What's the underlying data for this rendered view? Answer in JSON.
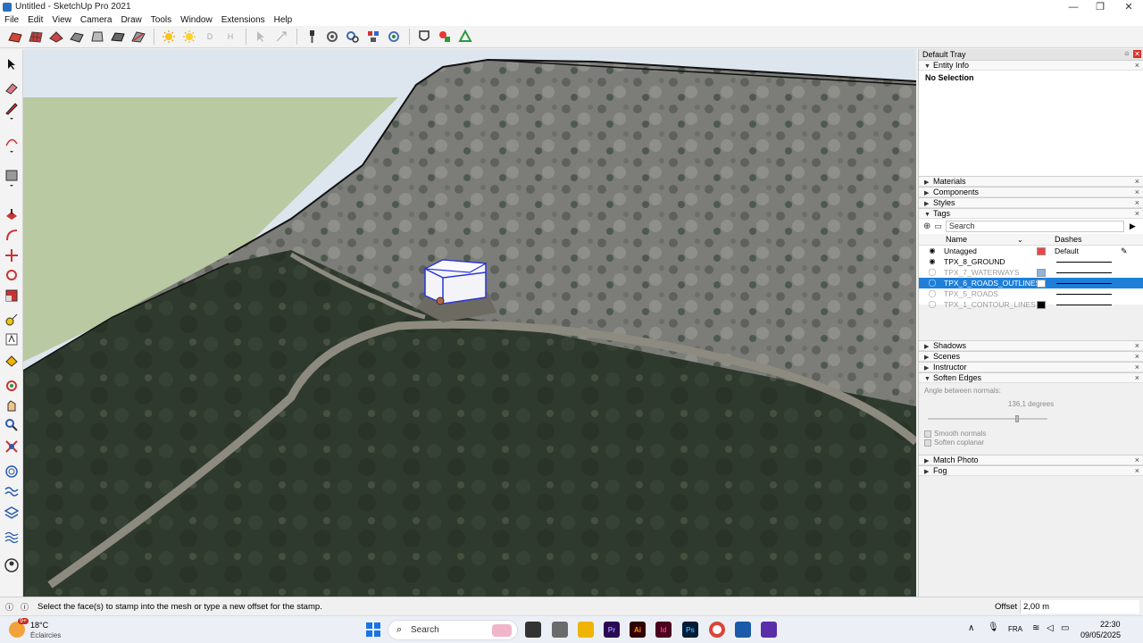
{
  "window": {
    "title": "Untitled - SketchUp Pro 2021",
    "minimize": "—",
    "maximize": "❐",
    "close": "✕"
  },
  "menu": [
    "File",
    "Edit",
    "View",
    "Camera",
    "Draw",
    "Tools",
    "Window",
    "Extensions",
    "Help"
  ],
  "toolbar": {
    "shadow_d": "D",
    "shadow_h": "H"
  },
  "tray": {
    "title": "Default Tray",
    "entity_info": {
      "label": "Entity Info",
      "selection": "No Selection"
    },
    "panels_top": [
      "Materials",
      "Components",
      "Styles"
    ],
    "tags": {
      "label": "Tags",
      "search_placeholder": "Search",
      "col_name": "Name",
      "col_dashes": "Dashes",
      "rows": [
        {
          "name": "Untagged",
          "color": "#e8474c",
          "dashes": "Default",
          "visible": true,
          "selected": false
        },
        {
          "name": "TPX_8_GROUND",
          "color": "",
          "dashes": "",
          "visible": true,
          "selected": false
        },
        {
          "name": "TPX_7_WATERWAYS",
          "color": "#8fb3d9",
          "dashes": "",
          "visible": false,
          "selected": false
        },
        {
          "name": "TPX_6_ROADS_OUTLINES",
          "color": "#ffffff",
          "dashes": "",
          "visible": false,
          "selected": true
        },
        {
          "name": "TPX_5_ROADS",
          "color": "",
          "dashes": "",
          "visible": false,
          "selected": false
        },
        {
          "name": "TPX_1_CONTOUR_LINES",
          "color": "#000000",
          "dashes": "",
          "visible": false,
          "selected": false
        }
      ]
    },
    "panels_mid": [
      "Shadows",
      "Scenes",
      "Instructor"
    ],
    "soften_edges": {
      "label": "Soften Edges",
      "angle_label": "Angle between normals:",
      "angle_value": "136,1  degrees",
      "slider_position": 0.75,
      "smooth_normals": "Smooth normals",
      "soften_coplanar": "Soften coplanar"
    },
    "panels_bottom": [
      "Match Photo",
      "Fog"
    ]
  },
  "status": {
    "message": "Select the face(s) to stamp into the mesh or type a new offset for the stamp.",
    "offset_label": "Offset",
    "offset_value": "2,00 m"
  },
  "taskbar": {
    "weather_temp": "18°C",
    "weather_desc": "Éclaircies",
    "weather_badge": "9+",
    "search": "Search",
    "lang": "FRA",
    "time": "22:30",
    "date": "09/05/2025",
    "apps": [
      {
        "label": "Pr",
        "color": "#2a0a52"
      },
      {
        "label": "Ai",
        "color": "#330000"
      },
      {
        "label": "Id",
        "color": "#49021f"
      },
      {
        "label": "Ps",
        "color": "#001e36"
      }
    ]
  },
  "colors": {
    "accent": "#1f7fd8",
    "sky": "#b9c9a2",
    "close_red": "#d9342b"
  }
}
